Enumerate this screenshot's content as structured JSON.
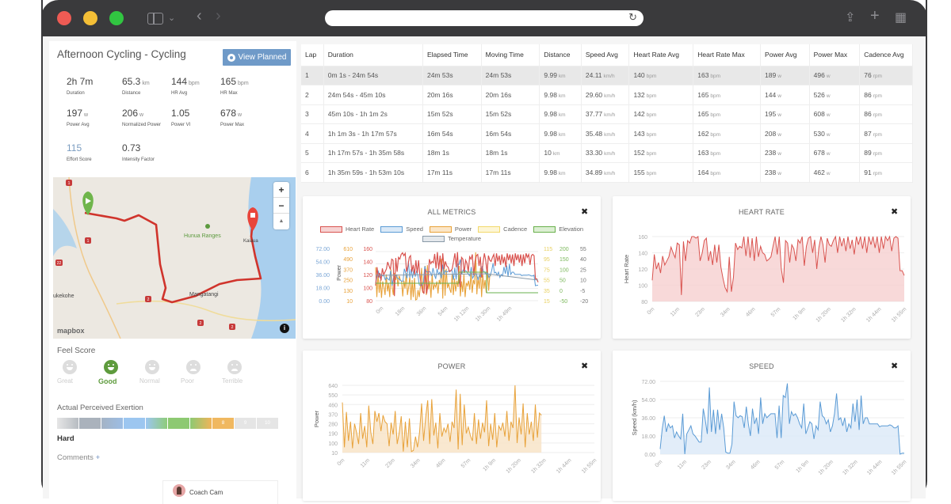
{
  "browser": {
    "back_label": "‹",
    "forward_label": "›",
    "reload_label": "↻",
    "share_label": "⇪",
    "new_tab_label": "+",
    "tabs_label": "▦",
    "sidebar_chevron": "⌄"
  },
  "activity": {
    "title": "Afternoon Cycling - Cycling",
    "view_planned_label": "View Planned",
    "stats": [
      {
        "value": "2h 7m",
        "unit": "",
        "label": "Duration"
      },
      {
        "value": "65.3",
        "unit": "km",
        "label": "Distance"
      },
      {
        "value": "144",
        "unit": "bpm",
        "label": "HR Avg"
      },
      {
        "value": "165",
        "unit": "bpm",
        "label": "HR Max"
      },
      {
        "value": "197",
        "unit": "w",
        "label": "Power Avg"
      },
      {
        "value": "206",
        "unit": "w",
        "label": "Normalized Power"
      },
      {
        "value": "1.05",
        "unit": "",
        "label": "Power VI"
      },
      {
        "value": "678",
        "unit": "w",
        "label": "Power Max"
      },
      {
        "value": "115",
        "unit": "",
        "label": "Effort Score"
      },
      {
        "value": "0.73",
        "unit": "",
        "label": "Intensity Factor"
      }
    ]
  },
  "map": {
    "labels": [
      "Hunua Ranges",
      "Kaiaua",
      "Mangatangi",
      "ukekohe"
    ],
    "road_shields": [
      "1",
      "1",
      "22",
      "2",
      "2",
      "2"
    ],
    "zoom_in": "+",
    "zoom_out": "−",
    "compass": "▲",
    "info": "i",
    "attribution": "mapbox"
  },
  "feel": {
    "title": "Feel Score",
    "options": [
      {
        "label": "Great",
        "active": false
      },
      {
        "label": "Good",
        "active": true
      },
      {
        "label": "Normal",
        "active": false
      },
      {
        "label": "Poor",
        "active": false
      },
      {
        "label": "Terrible",
        "active": false
      }
    ]
  },
  "rpe": {
    "title": "Actual Perceived Exertion",
    "selected": 8,
    "segments": [
      "",
      "",
      "",
      "",
      "",
      "",
      "",
      "8",
      "9",
      "10"
    ],
    "value_label": "Hard"
  },
  "comments": {
    "label": "Comments",
    "add": "+"
  },
  "coach": {
    "name": "Coach Cam"
  },
  "laps": {
    "columns": [
      "Lap",
      "Duration",
      "Elapsed Time",
      "Moving Time",
      "Distance",
      "Speed Avg",
      "Heart Rate Avg",
      "Heart Rate Max",
      "Power Avg",
      "Power Max",
      "Cadence Avg"
    ],
    "rows": [
      {
        "lap": "1",
        "duration": "0m 1s - 24m 54s",
        "elapsed": "24m 53s",
        "moving": "24m 53s",
        "distance": "9.99",
        "speed": "24.11",
        "hr_avg": "140",
        "hr_max": "163",
        "power_avg": "189",
        "power_max": "496",
        "cadence": "76"
      },
      {
        "lap": "2",
        "duration": "24m 54s - 45m 10s",
        "elapsed": "20m 16s",
        "moving": "20m 16s",
        "distance": "9.98",
        "speed": "29.60",
        "hr_avg": "132",
        "hr_max": "165",
        "power_avg": "144",
        "power_max": "526",
        "cadence": "86"
      },
      {
        "lap": "3",
        "duration": "45m 10s - 1h 1m 2s",
        "elapsed": "15m 52s",
        "moving": "15m 52s",
        "distance": "9.98",
        "speed": "37.77",
        "hr_avg": "142",
        "hr_max": "165",
        "power_avg": "195",
        "power_max": "608",
        "cadence": "86"
      },
      {
        "lap": "4",
        "duration": "1h 1m 3s - 1h 17m 57s",
        "elapsed": "16m 54s",
        "moving": "16m 54s",
        "distance": "9.98",
        "speed": "35.48",
        "hr_avg": "143",
        "hr_max": "162",
        "power_avg": "208",
        "power_max": "530",
        "cadence": "87"
      },
      {
        "lap": "5",
        "duration": "1h 17m 57s - 1h 35m 58s",
        "elapsed": "18m 1s",
        "moving": "18m 1s",
        "distance": "10",
        "speed": "33.30",
        "hr_avg": "152",
        "hr_max": "163",
        "power_avg": "238",
        "power_max": "678",
        "cadence": "89"
      },
      {
        "lap": "6",
        "duration": "1h 35m 59s - 1h 53m 10s",
        "elapsed": "17m 11s",
        "moving": "17m 11s",
        "distance": "9.98",
        "speed": "34.89",
        "hr_avg": "155",
        "hr_max": "164",
        "power_avg": "238",
        "power_max": "462",
        "cadence": "91"
      }
    ],
    "units": {
      "distance": "km",
      "speed": "km/h",
      "hr": "bpm",
      "power": "w",
      "cadence": "rpm"
    }
  },
  "chart_data": [
    {
      "id": "all-metrics",
      "type": "line",
      "title": "ALL METRICS",
      "legend": [
        {
          "name": "Heart Rate",
          "color": "#d9534f",
          "fill": "#f6d3d3"
        },
        {
          "name": "Speed",
          "color": "#5b9bd5",
          "fill": "#dbe9f7"
        },
        {
          "name": "Power",
          "color": "#e8a23a",
          "fill": "#fbe6c8"
        },
        {
          "name": "Cadence",
          "color": "#f2d96b",
          "fill": "#fdf6d6"
        },
        {
          "name": "Elevation",
          "color": "#6ab04c",
          "fill": "#dcefd3"
        },
        {
          "name": "Temperature",
          "color": "#8a9aa8",
          "fill": "#e4e8ec"
        }
      ],
      "axes": {
        "speed": {
          "ticks": [
            "72.00",
            "54.00",
            "36.00",
            "18.00",
            "0.00"
          ],
          "color": "#7aa6d6"
        },
        "power": {
          "label": "Power",
          "ticks": [
            "610",
            "490",
            "370",
            "250",
            "130",
            "10"
          ],
          "color": "#e8a23a"
        },
        "heart_rate": {
          "ticks": [
            "160",
            "140",
            "120",
            "100",
            "80"
          ],
          "color": "#d9534f"
        },
        "cadence": {
          "ticks": [
            "115",
            "95",
            "75",
            "55",
            "35",
            "15"
          ],
          "color": "#e8d060"
        },
        "elevation": {
          "ticks": [
            "200",
            "150",
            "100",
            "50",
            "0",
            "-50"
          ],
          "color": "#7cb85c"
        },
        "temperature": {
          "ticks": [
            "55",
            "40",
            "25",
            "10",
            "-5",
            "-20"
          ],
          "color": "#777"
        }
      },
      "x_ticks": [
        "0m",
        "18m",
        "36m",
        "54m",
        "1h 12m",
        "1h 30m",
        "1h 49m"
      ]
    },
    {
      "id": "heart-rate",
      "type": "area",
      "title": "HEART RATE",
      "ylabel": "Heart Rate",
      "color": "#d9534f",
      "fill": "#f6d0d0",
      "ylim": [
        80,
        170
      ],
      "y_ticks": [
        "160",
        "140",
        "120",
        "100",
        "80"
      ],
      "x_ticks": [
        "0m",
        "11m",
        "23m",
        "34m",
        "46m",
        "57m",
        "1h 9m",
        "1h 20m",
        "1h 32m",
        "1h 44m",
        "1h 55m"
      ],
      "values": [
        106,
        138,
        120,
        128,
        115,
        136,
        125,
        130,
        135,
        147,
        140,
        134,
        152,
        150,
        88,
        154,
        130,
        155,
        152,
        160,
        163,
        158,
        162,
        130,
        140,
        155,
        158,
        130,
        142,
        125,
        150,
        128,
        150,
        122,
        108,
        97,
        92,
        135,
        92,
        110,
        152,
        144,
        148,
        146,
        161,
        136,
        164,
        134,
        158,
        130,
        162,
        135,
        148,
        140,
        138,
        130,
        132,
        135,
        148,
        162,
        138,
        164,
        120,
        103,
        155,
        152,
        128,
        150,
        145,
        130,
        156,
        152,
        160,
        124,
        148,
        158,
        160,
        140,
        156,
        120,
        146,
        162,
        150,
        128,
        158,
        150,
        148,
        155,
        160,
        140,
        162,
        148,
        158,
        142,
        160,
        145,
        156,
        138,
        162,
        150,
        160,
        145,
        160,
        140,
        162,
        150,
        160,
        146,
        160,
        140,
        160,
        145,
        162,
        155,
        160,
        142,
        158,
        160,
        158,
        118,
        118,
        112
      ]
    },
    {
      "id": "power",
      "type": "area",
      "title": "POWER",
      "ylabel": "Power",
      "color": "#e8a23a",
      "fill": "#f8e2c4",
      "ylim": [
        10,
        680
      ],
      "y_ticks": [
        "640",
        "550",
        "460",
        "370",
        "280",
        "190",
        "100",
        "10"
      ],
      "x_ticks": [
        "0m",
        "11m",
        "23m",
        "34m",
        "46m",
        "57m",
        "1h 9m",
        "1h 20m",
        "1h 32m",
        "1h 44m",
        "1h 55m"
      ],
      "values": [
        480,
        60,
        390,
        120,
        300,
        50,
        280,
        200,
        90,
        380,
        140,
        260,
        60,
        450,
        200,
        90,
        400,
        300,
        380,
        210,
        360,
        300,
        280,
        70,
        290,
        180,
        400,
        90,
        200,
        350,
        20,
        300,
        60,
        330,
        20,
        30,
        160,
        60,
        200,
        470,
        120,
        340,
        500,
        90,
        510,
        170,
        290,
        50,
        380,
        160,
        240,
        200,
        280,
        110,
        300,
        240,
        600,
        40,
        560,
        80,
        460,
        190,
        250,
        170,
        120,
        380,
        90,
        320,
        140,
        290,
        200,
        500,
        70,
        280,
        130,
        380,
        60,
        260,
        220,
        290,
        160,
        400,
        120,
        300,
        240,
        690,
        100,
        340,
        180,
        470,
        60,
        380,
        180,
        300,
        120,
        460,
        150,
        380,
        360
      ]
    },
    {
      "id": "speed",
      "type": "area",
      "title": "SPEED",
      "ylabel": "Speed (km/h)",
      "color": "#5b9bd5",
      "fill": "#dbe9f7",
      "ylim": [
        0,
        72
      ],
      "y_ticks": [
        "72.00",
        "54.00",
        "36.00",
        "18.00",
        "0.00"
      ],
      "x_ticks": [
        "0m",
        "11m",
        "23m",
        "34m",
        "46m",
        "57m",
        "1h 9m",
        "1h 20m",
        "1h 32m",
        "1h 44m",
        "1h 55m"
      ],
      "values": [
        5,
        25,
        38,
        22,
        30,
        26,
        28,
        16,
        22,
        18,
        15,
        40,
        0,
        20,
        24,
        28,
        20,
        18,
        15,
        12,
        12,
        45,
        34,
        20,
        66,
        22,
        44,
        20,
        44,
        24,
        40,
        26,
        2,
        1,
        1,
        10,
        52,
        38,
        36,
        38,
        37,
        26,
        47,
        30,
        18,
        45,
        30,
        36,
        20,
        56,
        30,
        40,
        36,
        38,
        40,
        40,
        40,
        16,
        48,
        16,
        58,
        56,
        70,
        30,
        42,
        38,
        40,
        36,
        30,
        26,
        50,
        20,
        26,
        32,
        30,
        15,
        28,
        24,
        52,
        38,
        36,
        30,
        34,
        22,
        28,
        40,
        60,
        34,
        36,
        28,
        36,
        22,
        30,
        26,
        50,
        32,
        54,
        24,
        58,
        30,
        36,
        36,
        30,
        30,
        30,
        30,
        30,
        27,
        28,
        28,
        28,
        28,
        29,
        28,
        26,
        26,
        28,
        0,
        1,
        1
      ]
    }
  ]
}
